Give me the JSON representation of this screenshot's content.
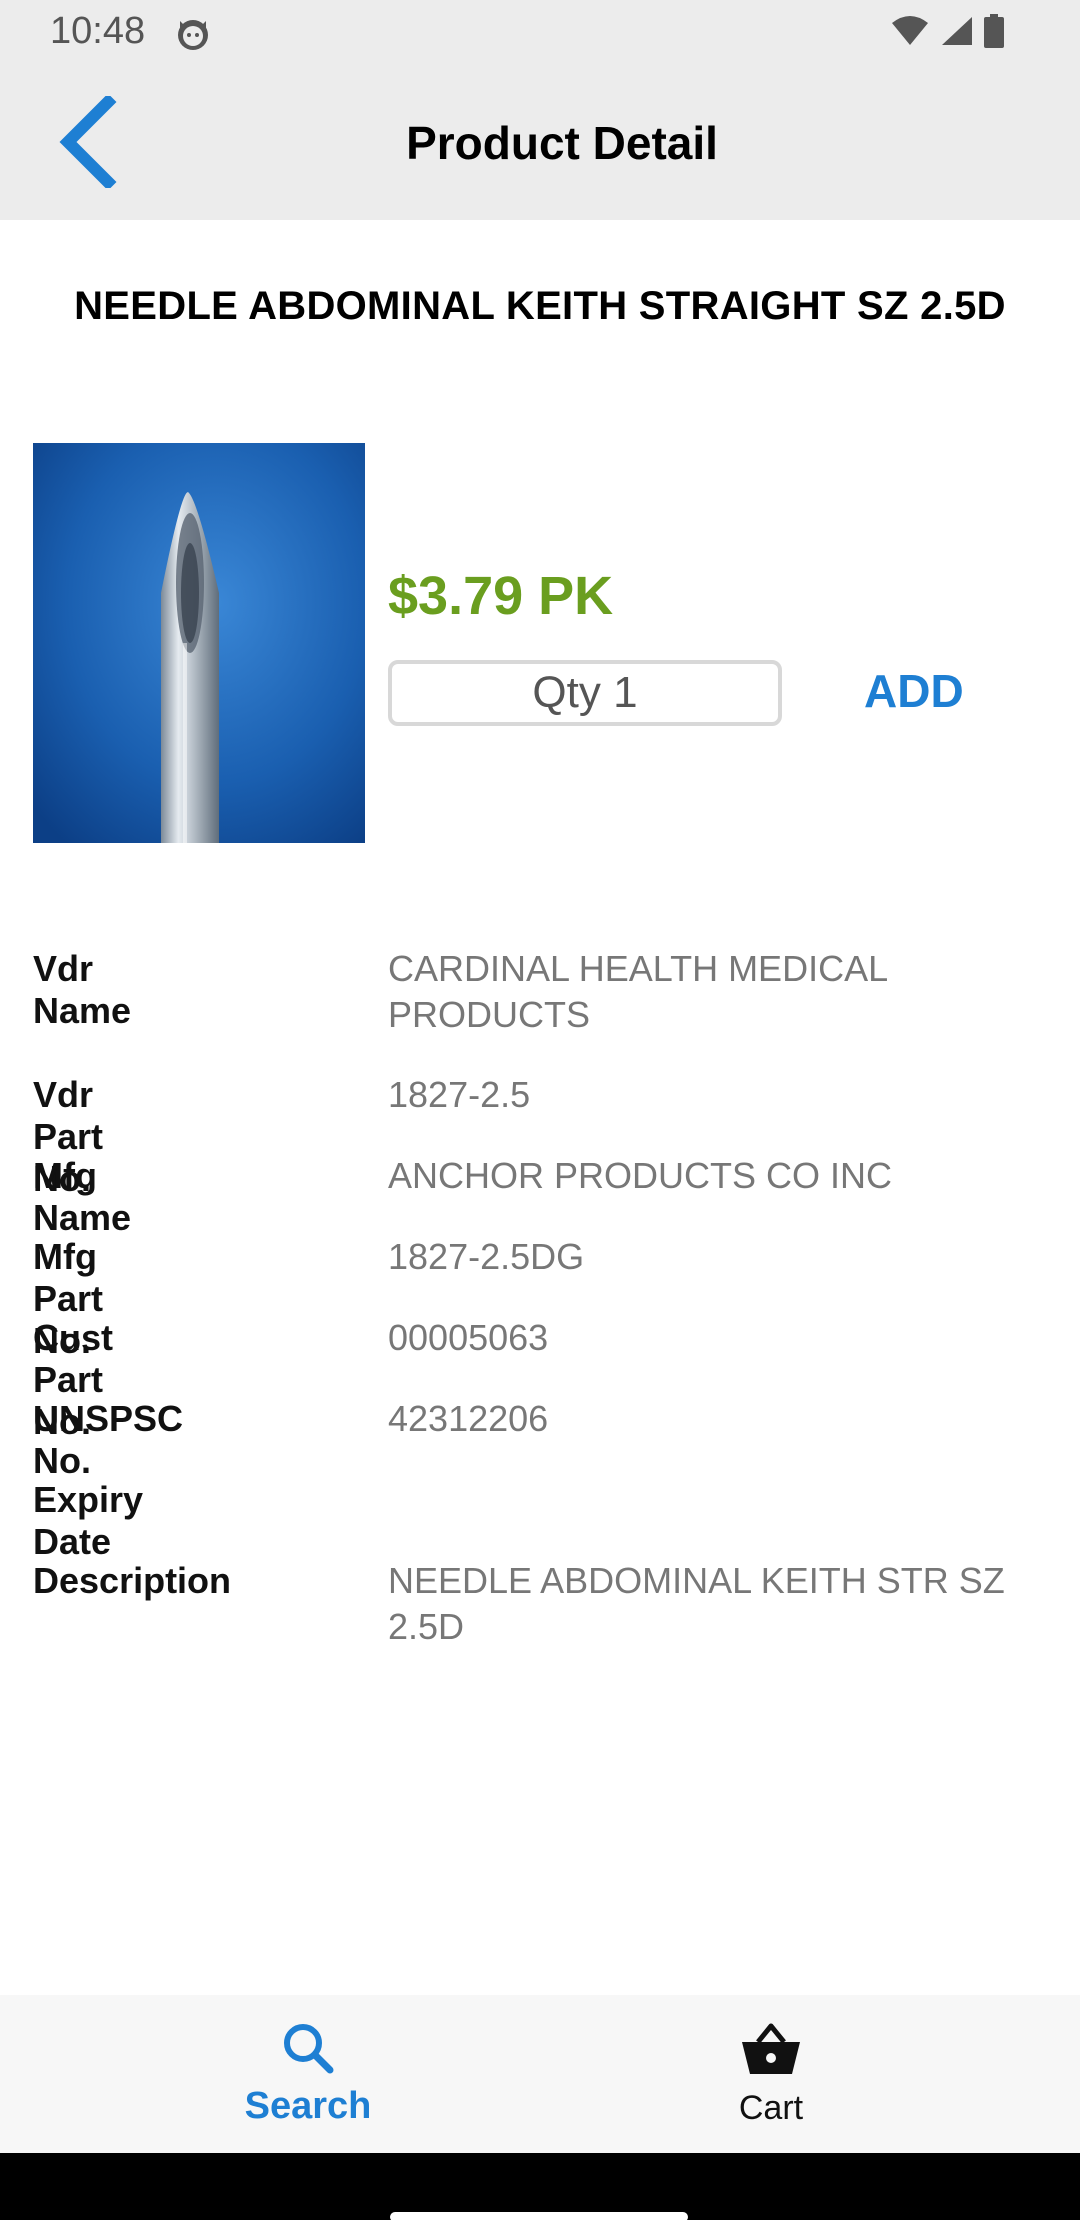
{
  "status_bar": {
    "time": "10:48",
    "icons": [
      "cat-app-icon",
      "wifi-icon",
      "signal-icon",
      "battery-icon"
    ]
  },
  "app_bar": {
    "title": "Product Detail",
    "back_icon": "chevron-left-icon",
    "accent_color": "#1e7fd3"
  },
  "product": {
    "title": "NEEDLE ABDOMINAL KEITH STRAIGHT SZ 2.5D",
    "image_icon": "needle-image",
    "price": "$3.79 PK",
    "price_color": "#6a9e1f",
    "qty_placeholder": "Qty 1",
    "add_label": "ADD"
  },
  "details": [
    {
      "label": "Vdr Name",
      "value": "CARDINAL HEALTH MEDICAL PRODUCTS"
    },
    {
      "label": "Vdr Part No.",
      "value": "1827-2.5"
    },
    {
      "label": "Mfg Name",
      "value": "ANCHOR PRODUCTS CO INC"
    },
    {
      "label": "Mfg Part No.",
      "value": "1827-2.5DG"
    },
    {
      "label": "Cust Part No.",
      "value": "00005063"
    },
    {
      "label": "UNSPSC No.",
      "value": "42312206"
    },
    {
      "label": "Expiry Date",
      "value": ""
    },
    {
      "label": "Description",
      "value": "NEEDLE ABDOMINAL KEITH STR SZ 2.5D"
    }
  ],
  "bottom_nav": {
    "search_label": "Search",
    "cart_label": "Cart",
    "active": "Search"
  }
}
